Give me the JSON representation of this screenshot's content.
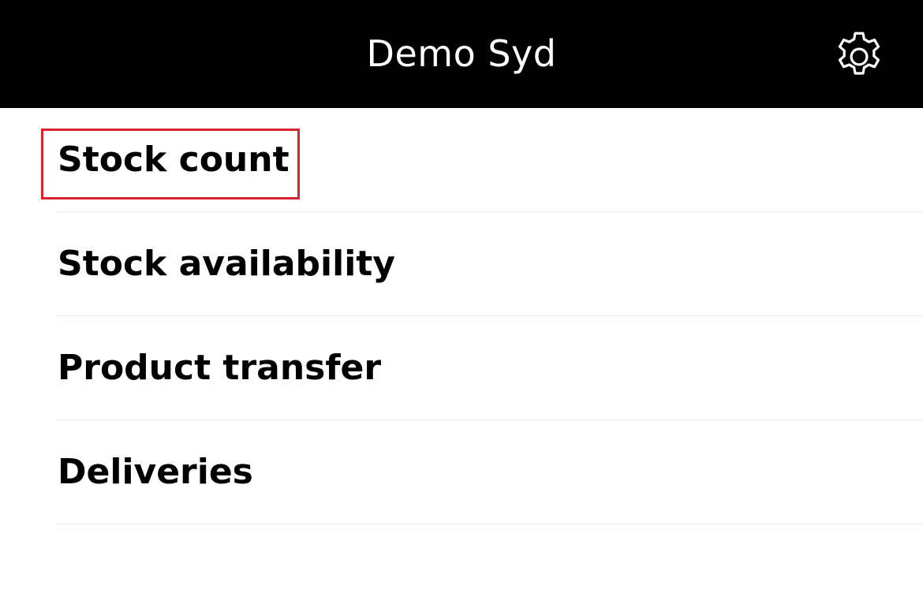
{
  "header": {
    "title": "Demo Syd",
    "settings_icon": "gear-icon"
  },
  "menu": {
    "items": [
      {
        "label": "Stock count",
        "highlighted": true
      },
      {
        "label": "Stock availability",
        "highlighted": false
      },
      {
        "label": "Product transfer",
        "highlighted": false
      },
      {
        "label": "Deliveries",
        "highlighted": false
      }
    ]
  },
  "colors": {
    "header_background": "#000000",
    "header_text": "#ffffff",
    "highlight_border": "#d7222c",
    "divider": "#ececec"
  }
}
